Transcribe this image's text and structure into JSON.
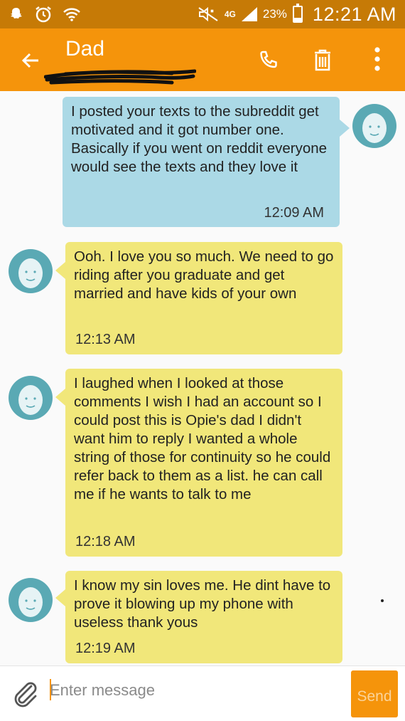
{
  "status_bar": {
    "time": "12:21 AM",
    "battery_percent": "23%",
    "battery_level": 0.23,
    "network": "4G",
    "icons": [
      "snapchat-icon",
      "alarm-icon",
      "wifi-icon",
      "mute-icon",
      "lte-icon",
      "signal-icon",
      "battery-icon"
    ]
  },
  "app_bar": {
    "title": "Dad",
    "icons": [
      "back-arrow-icon",
      "phone-icon",
      "trash-icon",
      "more-vert-icon"
    ],
    "color": "#f5940b"
  },
  "messages": [
    {
      "direction": "sent",
      "text": "I posted your texts to the subreddit get motivated and it got number one. Basically if you went on reddit everyone would see the texts and they love it",
      "time": "12:09 AM"
    },
    {
      "direction": "received",
      "text": "Ooh.  I love you so much.  We need to go riding after you graduate and get married and have kids of your own",
      "time": "12:13 AM"
    },
    {
      "direction": "received",
      "text": "I laughed when I looked at those comments I wish I had an account so I could post this is Opie's dad I didn't want him to reply I wanted a whole string of those for continuity so he could refer back to them as a list. he can call me if he wants to talk to me",
      "time": "12:18 AM"
    },
    {
      "direction": "received",
      "text": "I know my sin loves me. He dint have to prove it blowing up my phone with useless thank yous",
      "time": "12:19 AM"
    }
  ],
  "composer": {
    "placeholder": "Enter message",
    "value": "",
    "send_label": "Send"
  },
  "colors": {
    "accent": "#f5940b",
    "status_bar": "#c67a06",
    "sent_bubble": "#abd9e6",
    "received_bubble": "#f1e77a",
    "avatar": "#5aa9b4"
  }
}
